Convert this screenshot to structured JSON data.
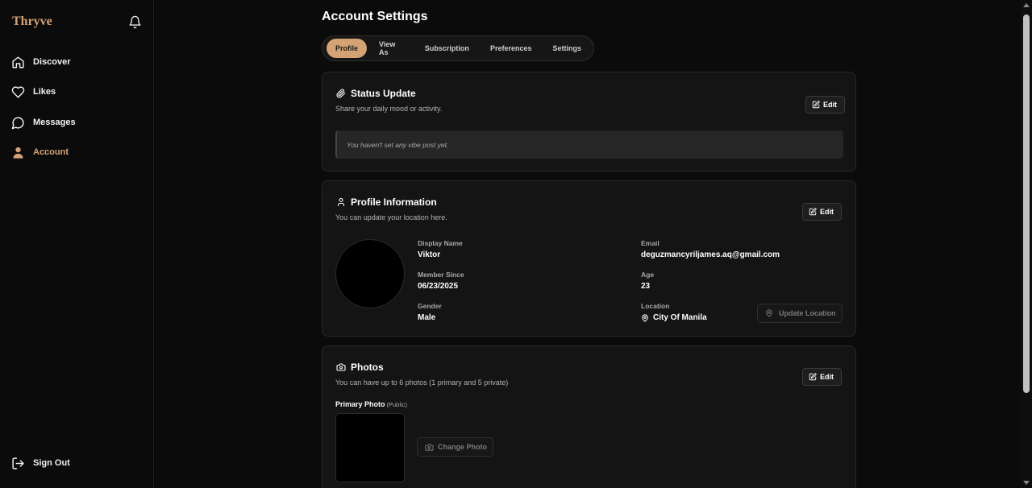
{
  "app": {
    "brand": "Thryve"
  },
  "sidebar": {
    "items": [
      {
        "label": "Discover",
        "icon": "home-icon"
      },
      {
        "label": "Likes",
        "icon": "heart-icon"
      },
      {
        "label": "Messages",
        "icon": "message-icon"
      },
      {
        "label": "Account",
        "icon": "user-icon",
        "active": true
      }
    ],
    "signout_label": "Sign Out"
  },
  "main": {
    "title": "Account Settings",
    "tabs": [
      {
        "label": "Profile",
        "active": true
      },
      {
        "label": "View As"
      },
      {
        "label": "Subscription"
      },
      {
        "label": "Preferences"
      },
      {
        "label": "Settings"
      }
    ]
  },
  "status_card": {
    "title": "Status Update",
    "subtitle": "Share your daily mood or activity.",
    "edit_label": "Edit",
    "empty_text": "You haven't set any vibe post yet."
  },
  "profile_card": {
    "title": "Profile Information",
    "subtitle": "You can update your location here.",
    "edit_label": "Edit",
    "fields": {
      "display_name": {
        "label": "Display Name",
        "value": "Viktor"
      },
      "member_since": {
        "label": "Member Since",
        "value": "06/23/2025"
      },
      "gender": {
        "label": "Gender",
        "value": "Male"
      },
      "email": {
        "label": "Email",
        "value": "deguzmancyriljames.aq@gmail.com"
      },
      "age": {
        "label": "Age",
        "value": "23"
      },
      "location": {
        "label": "Location",
        "value": "City Of Manila"
      }
    },
    "update_location_label": "Update Location"
  },
  "photos_card": {
    "title": "Photos",
    "subtitle": "You can have up to 6 photos (1 primary and 5 private)",
    "edit_label": "Edit",
    "primary_label": "Primary Photo",
    "primary_tag": "(Public)",
    "change_photo_label": "Change Photo"
  },
  "colors": {
    "accent": "#d4a373",
    "background": "#0b0b0b",
    "card": "#141414"
  }
}
